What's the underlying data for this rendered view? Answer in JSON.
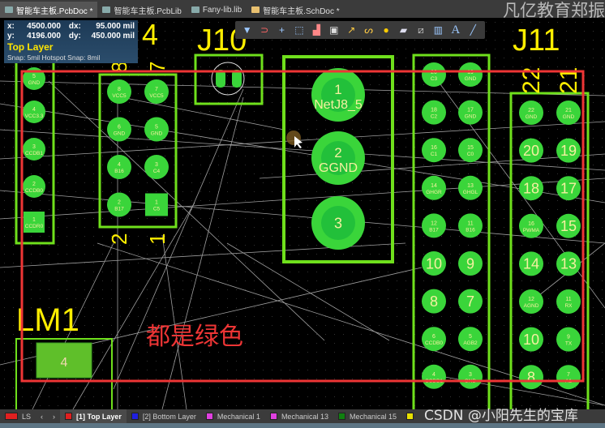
{
  "tabs": [
    {
      "label": "智能车主板.PcbDoc *",
      "active": true
    },
    {
      "label": "智能车主板.PcbLib"
    },
    {
      "label": "Fany-lib.lib"
    },
    {
      "label": "智能车主板.SchDoc *"
    }
  ],
  "watermark_top": "凡亿教育郑振",
  "info": {
    "x_label": "x:",
    "x": "4500.000",
    "dx_label": "dx:",
    "dx": "95.000 mil",
    "y_label": "y:",
    "y": "4196.000",
    "dy_label": "dy:",
    "dy": "450.000 mil",
    "layer": "Top Layer",
    "snap": "Snap: 5mil Hotspot Snap: 8mil"
  },
  "toolbar": [
    "filter-icon",
    "route-icon",
    "cross-icon",
    "select-rect-icon",
    "chart-icon",
    "component-icon",
    "interactive-route-icon",
    "length-tune-icon",
    "via-icon",
    "polygon-icon",
    "keepout-icon",
    "region-icon",
    "text-icon",
    "line-icon"
  ],
  "silk": {
    "c1": "4",
    "j10": "J10",
    "j11": "J11",
    "lm1": "LM1",
    "pin22": "22",
    "pin21": "21",
    "pin2": "2",
    "pin1": "1",
    "pin8": "8",
    "pin7": "7"
  },
  "components": {
    "left5": [
      {
        "n": "5",
        "net": "GND"
      },
      {
        "n": "4",
        "net": "VCC3.3"
      },
      {
        "n": "3",
        "net": "CCDB1"
      },
      {
        "n": "2",
        "net": "CCDB0"
      },
      {
        "n": "1",
        "net": "CCDR0",
        "square": true
      }
    ],
    "header8": [
      {
        "n": "8",
        "net": "VCC5"
      },
      {
        "n": "7",
        "net": "VCC5"
      },
      {
        "n": "6",
        "net": "GND"
      },
      {
        "n": "5",
        "net": "GND"
      },
      {
        "n": "4",
        "net": "B16"
      },
      {
        "n": "3",
        "net": "C4"
      },
      {
        "n": "2",
        "net": "B17"
      },
      {
        "n": "1",
        "net": "C5",
        "square": true
      }
    ],
    "j3": [
      {
        "n": "1",
        "net": "NetJ8_5"
      },
      {
        "n": "2",
        "net": "GGND"
      },
      {
        "n": "3",
        "net": ""
      }
    ],
    "j10": [
      {
        "n": "20",
        "net": "C3"
      },
      {
        "n": "19",
        "net": "GND"
      },
      {
        "n": "18",
        "net": "C2"
      },
      {
        "n": "17",
        "net": "GND"
      },
      {
        "n": "16",
        "net": "C1"
      },
      {
        "n": "15",
        "net": "C0"
      },
      {
        "n": "14",
        "net": "GHGR"
      },
      {
        "n": "13",
        "net": "GHGL"
      },
      {
        "n": "12",
        "net": "B17"
      },
      {
        "n": "11",
        "net": "B16"
      },
      {
        "n": "10",
        "net": ""
      },
      {
        "n": "9",
        "net": ""
      },
      {
        "n": "8",
        "net": ""
      },
      {
        "n": "7",
        "net": ""
      },
      {
        "n": "6",
        "net": "CCDB0"
      },
      {
        "n": "5",
        "net": "AGB2"
      },
      {
        "n": "4",
        "net": "CCDB1"
      },
      {
        "n": "3",
        "net": "GND"
      }
    ],
    "j11": [
      {
        "n": "22",
        "net": "GND"
      },
      {
        "n": "21",
        "net": "GND"
      },
      {
        "n": "20",
        "net": ""
      },
      {
        "n": "19",
        "net": ""
      },
      {
        "n": "18",
        "net": ""
      },
      {
        "n": "17",
        "net": ""
      },
      {
        "n": "16",
        "net": "PWMA"
      },
      {
        "n": "15",
        "net": ""
      },
      {
        "n": "14",
        "net": ""
      },
      {
        "n": "13",
        "net": ""
      },
      {
        "n": "12",
        "net": "AGND"
      },
      {
        "n": "11",
        "net": "RX"
      },
      {
        "n": "10",
        "net": ""
      },
      {
        "n": "9",
        "net": "TX"
      },
      {
        "n": "8",
        "net": ""
      },
      {
        "n": "7",
        "net": "A1"
      }
    ],
    "lm1": [
      {
        "n": "4",
        "net": ""
      }
    ]
  },
  "annotation": "都是绿色",
  "colors": {
    "pad": "#3ad53a",
    "outline": "#6fe01c",
    "silk": "#ffee00",
    "annotation": "#ee3535",
    "background": "#000000"
  },
  "layerbar": {
    "ls": "LS",
    "layers": [
      {
        "label": "[1] Top Layer",
        "color": "#e02020",
        "active": true
      },
      {
        "label": "[2] Bottom Layer",
        "color": "#2020e0"
      },
      {
        "label": "Mechanical 1",
        "color": "#e040e0"
      },
      {
        "label": "Mechanical 13",
        "color": "#e040e0"
      },
      {
        "label": "Mechanical 15",
        "color": "#108010"
      }
    ],
    "overlay_color": "#e8e000"
  },
  "watermark_bottom": "CSDN @小阳先生的宝库"
}
